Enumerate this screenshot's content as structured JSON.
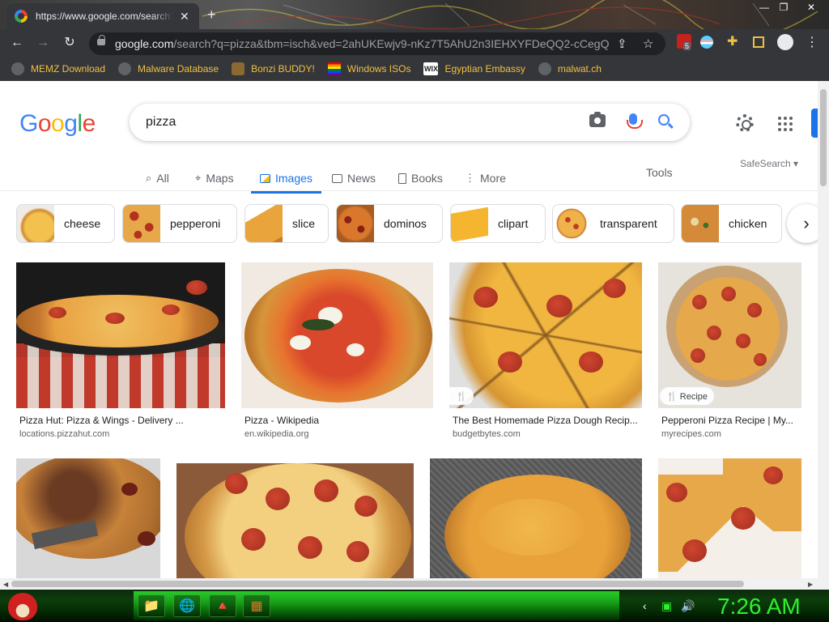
{
  "browser": {
    "tab_title": "https://www.google.com/search?q=pizza",
    "tab_close": "✕",
    "new_tab": "+",
    "window_controls": [
      "—",
      "❐",
      "✕"
    ],
    "nav": {
      "back": "←",
      "forward": "→",
      "reload": "↻"
    },
    "url_host": "google.com",
    "url_path": "/search?q=pizza&tbm=isch&ved=2ahUKEwjv9-nKz7T5AhU2n3IEHXYFDeQQ2-cCegQ...",
    "ext_badge": "5",
    "bookmarks": [
      {
        "label": "MEMZ Download",
        "icon": "globe-icon"
      },
      {
        "label": "Malware Database",
        "icon": "globe-icon"
      },
      {
        "label": "Bonzi BUDDY!",
        "icon": "bonzi-icon"
      },
      {
        "label": "Windows ISOs",
        "icon": "rainbow-flag-icon"
      },
      {
        "label": "Egyptian Embassy",
        "icon": "wix-icon",
        "icon_text": "WIX"
      },
      {
        "label": "malwat.ch",
        "icon": "globe-icon"
      }
    ]
  },
  "google": {
    "logo_letters": [
      "G",
      "o",
      "o",
      "g",
      "l",
      "e"
    ],
    "query": "pizza",
    "tabs": [
      {
        "label": "All",
        "icon": "🔍"
      },
      {
        "label": "Maps",
        "icon": "📍"
      },
      {
        "label": "Images",
        "icon": "🖼",
        "active": true
      },
      {
        "label": "News",
        "icon": "📰"
      },
      {
        "label": "Books",
        "icon": "📘"
      },
      {
        "label": "More",
        "icon": "⋮"
      }
    ],
    "tools": "Tools",
    "safesearch": "SafeSearch ▾",
    "chips": [
      "cheese",
      "pepperoni",
      "slice",
      "dominos",
      "clipart",
      "transparent",
      "chicken"
    ],
    "chip_next": "›",
    "results": [
      {
        "title": "Pizza Hut: Pizza & Wings - Delivery ...",
        "source": "locations.pizzahut.com"
      },
      {
        "title": "Pizza - Wikipedia",
        "source": "en.wikipedia.org"
      },
      {
        "title": "The Best Homemade Pizza Dough Recip...",
        "source": "budgetbytes.com",
        "badge": "🍴"
      },
      {
        "title": "Pepperoni Pizza Recipe | My...",
        "source": "myrecipes.com",
        "badge": "🍴 Recipe"
      }
    ]
  },
  "taskbar": {
    "clock": "7:26 AM",
    "apps": [
      "📁",
      "🌐",
      "🔺",
      "▦",
      "▬"
    ],
    "tray": [
      "‹",
      "▣",
      "🔊"
    ]
  }
}
